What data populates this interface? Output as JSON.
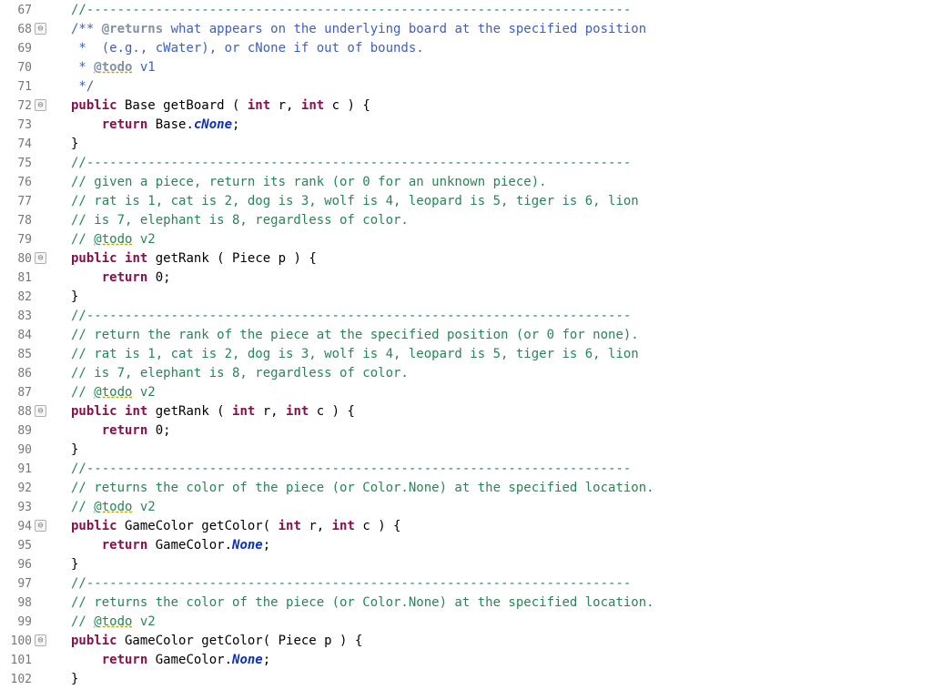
{
  "lines": [
    {
      "n": 67,
      "fold": "",
      "tokens": [
        {
          "cls": "c-comment",
          "t": "//-----------------------------------------------------------------------"
        }
      ]
    },
    {
      "n": 68,
      "fold": "⊖",
      "tokens": [
        {
          "cls": "c-doc",
          "t": "/** "
        },
        {
          "cls": "c-tag",
          "t": "@returns"
        },
        {
          "cls": "c-doc",
          "t": " what appears on the underlying board at the specified position"
        }
      ]
    },
    {
      "n": 69,
      "fold": "",
      "tokens": [
        {
          "cls": "c-doc",
          "t": " *  (e.g., cWater), or cNone if out of bounds."
        }
      ]
    },
    {
      "n": 70,
      "fold": "",
      "tokens": [
        {
          "cls": "c-doc",
          "t": " * "
        },
        {
          "cls": "c-tag squig",
          "t": "@todo"
        },
        {
          "cls": "c-doc",
          "t": " v1"
        }
      ]
    },
    {
      "n": 71,
      "fold": "",
      "tokens": [
        {
          "cls": "c-doc",
          "t": " */"
        }
      ]
    },
    {
      "n": 72,
      "fold": "⊖",
      "tokens": [
        {
          "cls": "c-kw",
          "t": "public"
        },
        {
          "cls": "",
          "t": " Base getBoard ( "
        },
        {
          "cls": "c-kw",
          "t": "int"
        },
        {
          "cls": "",
          "t": " r, "
        },
        {
          "cls": "c-kw",
          "t": "int"
        },
        {
          "cls": "",
          "t": " c ) {"
        }
      ]
    },
    {
      "n": 73,
      "fold": "",
      "tokens": [
        {
          "cls": "",
          "t": "    "
        },
        {
          "cls": "c-kw",
          "t": "return"
        },
        {
          "cls": "",
          "t": " Base."
        },
        {
          "cls": "c-static",
          "t": "cNone"
        },
        {
          "cls": "",
          "t": ";"
        }
      ]
    },
    {
      "n": 74,
      "fold": "",
      "tokens": [
        {
          "cls": "",
          "t": "}"
        }
      ]
    },
    {
      "n": 75,
      "fold": "",
      "tokens": [
        {
          "cls": "c-comment",
          "t": "//-----------------------------------------------------------------------"
        }
      ]
    },
    {
      "n": 76,
      "fold": "",
      "tokens": [
        {
          "cls": "c-comment",
          "t": "// given a piece, return its rank (or 0 for an unknown piece)."
        }
      ]
    },
    {
      "n": 77,
      "fold": "",
      "tokens": [
        {
          "cls": "c-comment",
          "t": "// rat is 1, cat is 2, dog is 3, wolf is 4, leopard is 5, tiger is 6, lion"
        }
      ]
    },
    {
      "n": 78,
      "fold": "",
      "tokens": [
        {
          "cls": "c-comment",
          "t": "// is 7, elephant is 8, regardless of color."
        }
      ]
    },
    {
      "n": 79,
      "fold": "",
      "tokens": [
        {
          "cls": "c-comment",
          "t": "// "
        },
        {
          "cls": "c-comment squig",
          "t": "@todo"
        },
        {
          "cls": "c-comment",
          "t": " v2"
        }
      ]
    },
    {
      "n": 80,
      "fold": "⊖",
      "tokens": [
        {
          "cls": "c-kw",
          "t": "public"
        },
        {
          "cls": "",
          "t": " "
        },
        {
          "cls": "c-kw",
          "t": "int"
        },
        {
          "cls": "",
          "t": " getRank ( Piece p ) {"
        }
      ]
    },
    {
      "n": 81,
      "fold": "",
      "tokens": [
        {
          "cls": "",
          "t": "    "
        },
        {
          "cls": "c-kw",
          "t": "return"
        },
        {
          "cls": "",
          "t": " 0;"
        }
      ]
    },
    {
      "n": 82,
      "fold": "",
      "tokens": [
        {
          "cls": "",
          "t": "}"
        }
      ]
    },
    {
      "n": 83,
      "fold": "",
      "tokens": [
        {
          "cls": "c-comment",
          "t": "//-----------------------------------------------------------------------"
        }
      ]
    },
    {
      "n": 84,
      "fold": "",
      "tokens": [
        {
          "cls": "c-comment",
          "t": "// return the rank of the piece at the specified position (or 0 for none)."
        }
      ]
    },
    {
      "n": 85,
      "fold": "",
      "tokens": [
        {
          "cls": "c-comment",
          "t": "// rat is 1, cat is 2, dog is 3, wolf is 4, leopard is 5, tiger is 6, lion"
        }
      ]
    },
    {
      "n": 86,
      "fold": "",
      "tokens": [
        {
          "cls": "c-comment",
          "t": "// is 7, elephant is 8, regardless of color."
        }
      ]
    },
    {
      "n": 87,
      "fold": "",
      "tokens": [
        {
          "cls": "c-comment",
          "t": "// "
        },
        {
          "cls": "c-comment squig",
          "t": "@todo"
        },
        {
          "cls": "c-comment",
          "t": " v2"
        }
      ]
    },
    {
      "n": 88,
      "fold": "⊖",
      "tokens": [
        {
          "cls": "c-kw",
          "t": "public"
        },
        {
          "cls": "",
          "t": " "
        },
        {
          "cls": "c-kw",
          "t": "int"
        },
        {
          "cls": "",
          "t": " getRank ( "
        },
        {
          "cls": "c-kw",
          "t": "int"
        },
        {
          "cls": "",
          "t": " r, "
        },
        {
          "cls": "c-kw",
          "t": "int"
        },
        {
          "cls": "",
          "t": " c ) {"
        }
      ]
    },
    {
      "n": 89,
      "fold": "",
      "tokens": [
        {
          "cls": "",
          "t": "    "
        },
        {
          "cls": "c-kw",
          "t": "return"
        },
        {
          "cls": "",
          "t": " 0;"
        }
      ]
    },
    {
      "n": 90,
      "fold": "",
      "tokens": [
        {
          "cls": "",
          "t": "}"
        }
      ]
    },
    {
      "n": 91,
      "fold": "",
      "tokens": [
        {
          "cls": "c-comment",
          "t": "//-----------------------------------------------------------------------"
        }
      ]
    },
    {
      "n": 92,
      "fold": "",
      "tokens": [
        {
          "cls": "c-comment",
          "t": "// returns the color of the piece (or Color.None) at the specified location."
        }
      ]
    },
    {
      "n": 93,
      "fold": "",
      "tokens": [
        {
          "cls": "c-comment",
          "t": "// "
        },
        {
          "cls": "c-comment squig",
          "t": "@todo"
        },
        {
          "cls": "c-comment",
          "t": " v2"
        }
      ]
    },
    {
      "n": 94,
      "fold": "⊖",
      "tokens": [
        {
          "cls": "c-kw",
          "t": "public"
        },
        {
          "cls": "",
          "t": " GameColor getColor( "
        },
        {
          "cls": "c-kw",
          "t": "int"
        },
        {
          "cls": "",
          "t": " r, "
        },
        {
          "cls": "c-kw",
          "t": "int"
        },
        {
          "cls": "",
          "t": " c ) {"
        }
      ]
    },
    {
      "n": 95,
      "fold": "",
      "tokens": [
        {
          "cls": "",
          "t": "    "
        },
        {
          "cls": "c-kw",
          "t": "return"
        },
        {
          "cls": "",
          "t": " GameColor."
        },
        {
          "cls": "c-static",
          "t": "None"
        },
        {
          "cls": "",
          "t": ";"
        }
      ]
    },
    {
      "n": 96,
      "fold": "",
      "tokens": [
        {
          "cls": "",
          "t": "}"
        }
      ]
    },
    {
      "n": 97,
      "fold": "",
      "tokens": [
        {
          "cls": "c-comment",
          "t": "//-----------------------------------------------------------------------"
        }
      ]
    },
    {
      "n": 98,
      "fold": "",
      "tokens": [
        {
          "cls": "c-comment",
          "t": "// returns the color of the piece (or Color.None) at the specified location."
        }
      ]
    },
    {
      "n": 99,
      "fold": "",
      "tokens": [
        {
          "cls": "c-comment",
          "t": "// "
        },
        {
          "cls": "c-comment squig",
          "t": "@todo"
        },
        {
          "cls": "c-comment",
          "t": " v2"
        }
      ]
    },
    {
      "n": 100,
      "fold": "⊖",
      "tokens": [
        {
          "cls": "c-kw",
          "t": "public"
        },
        {
          "cls": "",
          "t": " GameColor getColor( Piece p ) {"
        }
      ]
    },
    {
      "n": 101,
      "fold": "",
      "tokens": [
        {
          "cls": "",
          "t": "    "
        },
        {
          "cls": "c-kw",
          "t": "return"
        },
        {
          "cls": "",
          "t": " GameColor."
        },
        {
          "cls": "c-static",
          "t": "None"
        },
        {
          "cls": "",
          "t": ";"
        }
      ]
    },
    {
      "n": 102,
      "fold": "",
      "tokens": [
        {
          "cls": "",
          "t": "}"
        }
      ]
    }
  ]
}
